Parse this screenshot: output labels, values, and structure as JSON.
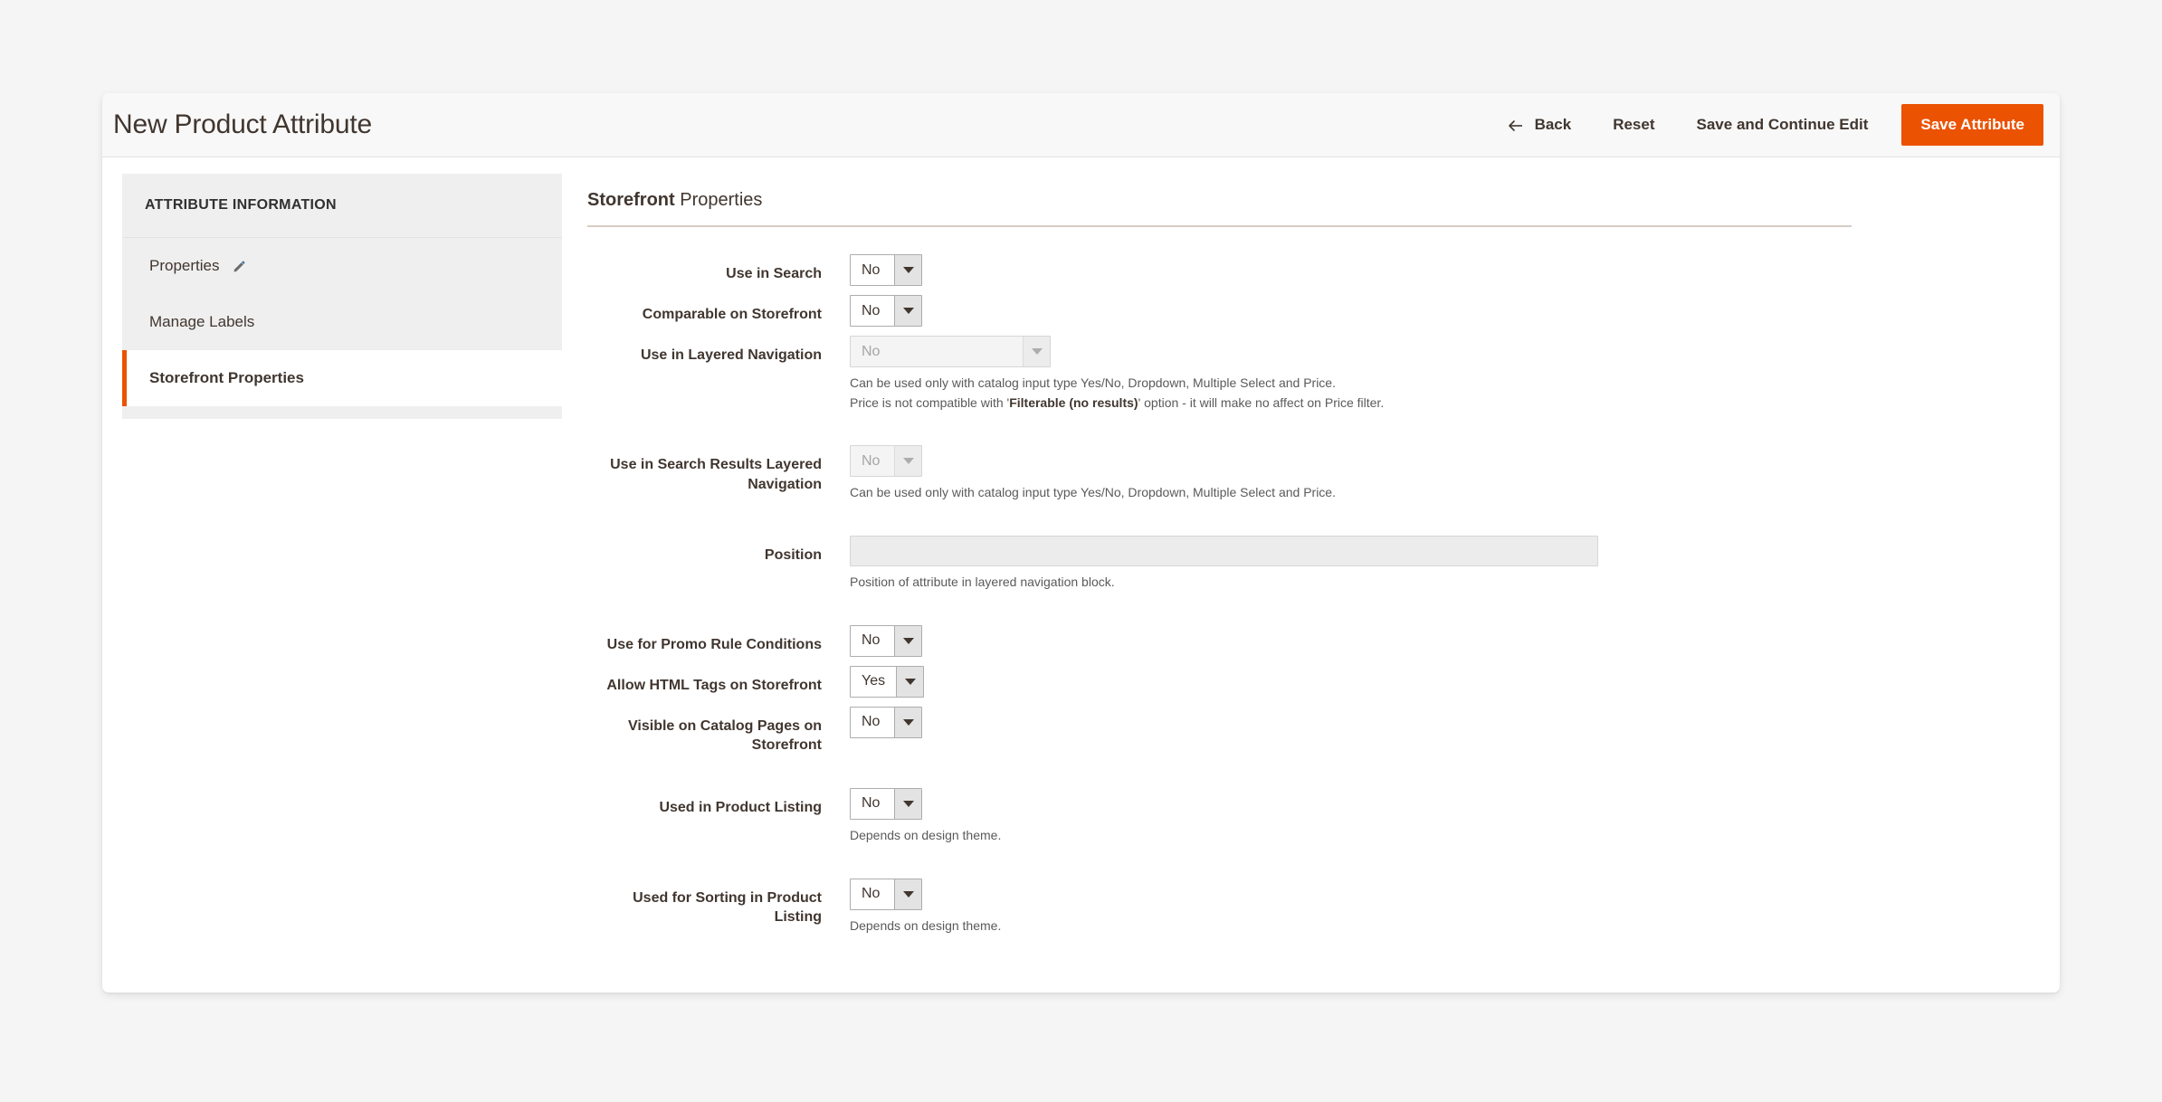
{
  "header": {
    "title": "New Product Attribute",
    "back_label": "Back",
    "back_icon": "arrow-left-icon",
    "reset_label": "Reset",
    "save_continue_label": "Save and Continue Edit",
    "save_label": "Save Attribute",
    "primary_color": "#eb5202"
  },
  "sidebar": {
    "title": "ATTRIBUTE INFORMATION",
    "items": [
      {
        "label": "Properties",
        "icon": "pencil-icon",
        "active": false
      },
      {
        "label": "Manage Labels",
        "icon": "",
        "active": false
      },
      {
        "label": "Storefront Properties",
        "icon": "",
        "active": true
      }
    ],
    "active_accent": "#eb5202"
  },
  "main": {
    "section_title_strong": "Storefront",
    "section_title_rest": " Properties",
    "fields": {
      "use_in_search": {
        "label": "Use in Search",
        "value": "No",
        "disabled": false
      },
      "comparable_on_storefront": {
        "label": "Comparable on Storefront",
        "value": "No",
        "disabled": false
      },
      "use_in_layered_navigation": {
        "label": "Use in Layered Navigation",
        "value": "No",
        "disabled": true,
        "note_line1": "Can be used only with catalog input type Yes/No, Dropdown, Multiple Select and Price.",
        "note_line2_pre": "Price is not compatible with '",
        "note_line2_strong": "Filterable (no results)",
        "note_line2_post": "' option - it will make no affect on Price filter."
      },
      "use_in_search_results_layered_navigation": {
        "label": "Use in Search Results Layered Navigation",
        "value": "No",
        "disabled": true,
        "note": "Can be used only with catalog input type Yes/No, Dropdown, Multiple Select and Price."
      },
      "position": {
        "label": "Position",
        "value": "",
        "placeholder": "",
        "disabled": true,
        "note": "Position of attribute in layered navigation block."
      },
      "use_for_promo_rule_conditions": {
        "label": "Use for Promo Rule Conditions",
        "value": "No",
        "disabled": false
      },
      "allow_html_tags_on_storefront": {
        "label": "Allow HTML Tags on Storefront",
        "value": "Yes",
        "disabled": false
      },
      "visible_on_catalog_pages_on_storefront": {
        "label": "Visible on Catalog Pages on Storefront",
        "value": "No",
        "disabled": false
      },
      "used_in_product_listing": {
        "label": "Used in Product Listing",
        "value": "No",
        "disabled": false,
        "note": "Depends on design theme."
      },
      "used_for_sorting_in_product_listing": {
        "label": "Used for Sorting in Product Listing",
        "value": "No",
        "disabled": false,
        "note": "Depends on design theme."
      }
    }
  }
}
